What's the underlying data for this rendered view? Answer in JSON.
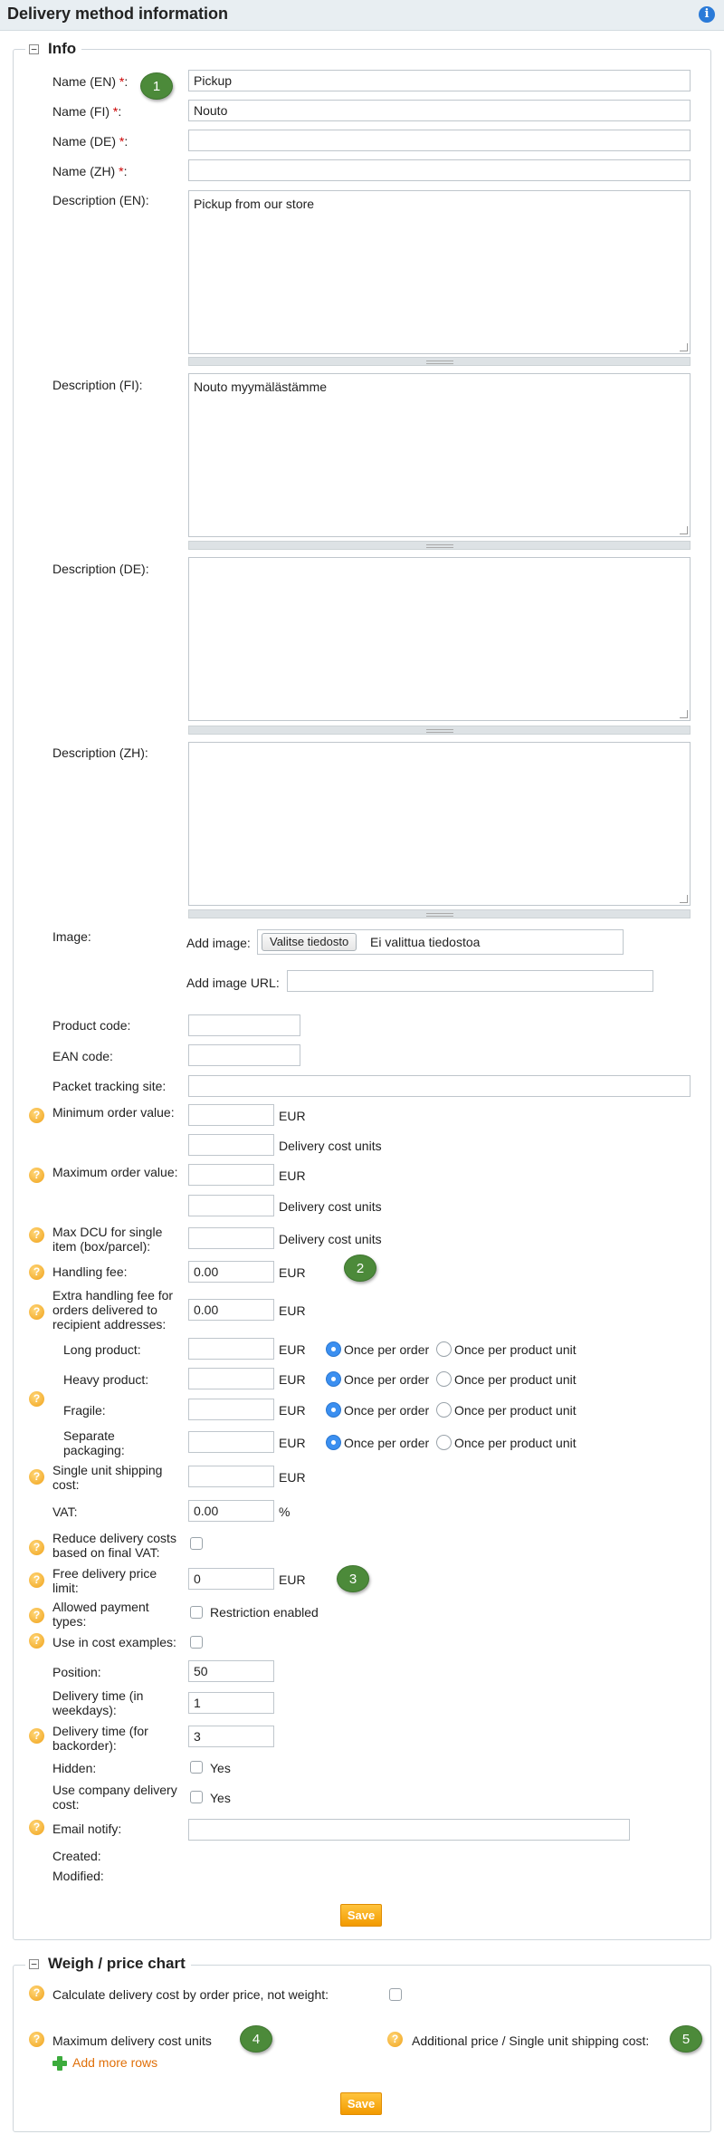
{
  "header": {
    "title": "Delivery method information",
    "info_icon": "info-icon"
  },
  "info": {
    "legend": "Info",
    "toggle": "−",
    "required_mark": "*",
    "name_en": {
      "label": "Name (EN)",
      "colon": ":",
      "value": "Pickup"
    },
    "name_fi": {
      "label": "Name (FI)",
      "colon": ":",
      "value": "Nouto"
    },
    "name_de": {
      "label": "Name (DE)",
      "colon": ":",
      "value": ""
    },
    "name_zh": {
      "label": "Name (ZH)",
      "colon": ":",
      "value": ""
    },
    "desc_en": {
      "label": "Description (EN):",
      "value": "Pickup from our store"
    },
    "desc_fi": {
      "label": "Description (FI):",
      "value": "Nouto myymälästämme"
    },
    "desc_de": {
      "label": "Description (DE):",
      "value": ""
    },
    "desc_zh": {
      "label": "Description (ZH):",
      "value": ""
    },
    "image": {
      "label": "Image:",
      "add_image_label": "Add image:",
      "file_button": "Valitse tiedosto",
      "file_status": "Ei valittua tiedostoa",
      "add_url_label": "Add image URL:",
      "url_value": ""
    },
    "product_code": {
      "label": "Product code:",
      "value": ""
    },
    "ean_code": {
      "label": "EAN code:",
      "value": ""
    },
    "tracking_site": {
      "label": "Packet tracking site:",
      "value": ""
    },
    "min_order": {
      "label": "Minimum order value:",
      "value": "",
      "unit": "EUR",
      "dcu_value": "",
      "dcu_unit": "Delivery cost units"
    },
    "max_order": {
      "label": "Maximum order value:",
      "value": "",
      "unit": "EUR",
      "dcu_value": "",
      "dcu_unit": "Delivery cost units"
    },
    "max_dcu": {
      "label_1": "Max DCU for single",
      "label_2": "item (box/parcel):",
      "value": "",
      "unit": "Delivery cost units"
    },
    "handling_fee": {
      "label": "Handling fee:",
      "value": "0.00",
      "unit": "EUR"
    },
    "extra_handling": {
      "label_1": "Extra handling fee for",
      "label_2": "orders delivered to",
      "label_3": "recipient addresses:",
      "value": "0.00",
      "unit": "EUR"
    },
    "products": [
      {
        "label": "Long product:",
        "value": "",
        "unit": "EUR",
        "opt1": "Once per order",
        "opt2": "Once per product unit"
      },
      {
        "label": "Heavy product:",
        "value": "",
        "unit": "EUR",
        "opt1": "Once per order",
        "opt2": "Once per product unit"
      },
      {
        "label": "Fragile:",
        "value": "",
        "unit": "EUR",
        "opt1": "Once per order",
        "opt2": "Once per product unit"
      },
      {
        "label_1": "Separate",
        "label_2": "packaging:",
        "value": "",
        "unit": "EUR",
        "opt1": "Once per order",
        "opt2": "Once per product unit"
      }
    ],
    "single_unit": {
      "label_1": "Single unit shipping",
      "label_2": "cost:",
      "value": "",
      "unit": "EUR"
    },
    "vat": {
      "label": "VAT:",
      "value": "0.00",
      "unit": "%"
    },
    "reduce_vat": {
      "label_1": "Reduce delivery costs",
      "label_2": "based on final VAT:"
    },
    "free_limit": {
      "label_1": "Free delivery price",
      "label_2": "limit:",
      "value": "0",
      "unit": "EUR"
    },
    "payment_types": {
      "label_1": "Allowed payment",
      "label_2": "types:",
      "option": "Restriction enabled"
    },
    "cost_examples": {
      "label": "Use in cost examples:"
    },
    "position": {
      "label": "Position:",
      "value": "50"
    },
    "delivery_time": {
      "label_1": "Delivery time (in",
      "label_2": "weekdays):",
      "value": "1"
    },
    "delivery_backorder": {
      "label_1": "Delivery time (for",
      "label_2": "backorder):",
      "value": "3"
    },
    "hidden": {
      "label": "Hidden:",
      "option": "Yes"
    },
    "company_cost": {
      "label_1": "Use company delivery",
      "label_2": "cost:",
      "option": "Yes"
    },
    "email_notify": {
      "label": "Email notify:",
      "value": ""
    },
    "created": {
      "label": "Created:"
    },
    "modified": {
      "label": "Modified:"
    },
    "save": "Save",
    "help_glyph": "?"
  },
  "chart": {
    "legend": "Weigh / price chart",
    "toggle": "−",
    "calc_by_price": "Calculate delivery cost by order price, not weight:",
    "max_dcu": "Maximum delivery cost units",
    "add_rows": "Add more rows",
    "additional_price": "Additional price / Single unit shipping cost:",
    "save": "Save"
  },
  "badges": [
    "1",
    "2",
    "3",
    "4",
    "5"
  ],
  "colors": {
    "accent_orange": "#f29a00",
    "badge_green": "#4c8a3a",
    "radio_blue": "#3b8ff0",
    "link_orange": "#e0700a"
  }
}
